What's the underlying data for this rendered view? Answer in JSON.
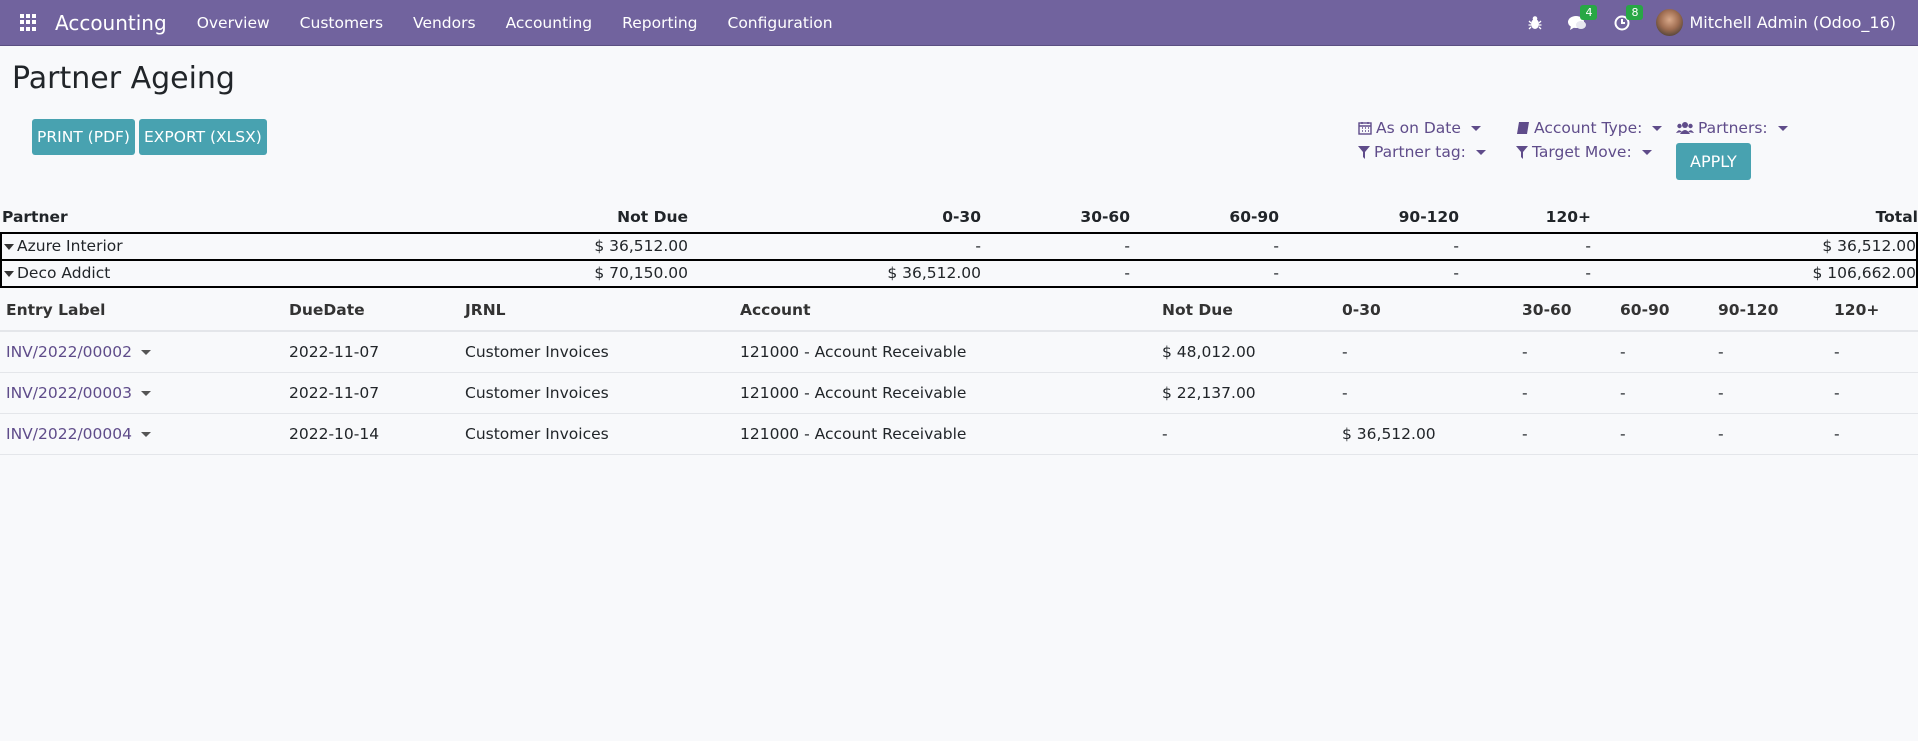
{
  "topbar": {
    "app_name": "Accounting",
    "menu": [
      "Overview",
      "Customers",
      "Vendors",
      "Accounting",
      "Reporting",
      "Configuration"
    ],
    "messages_count": "4",
    "activities_count": "8",
    "user": "Mitchell Admin (Odoo_16)",
    "bar_color": "#71639e"
  },
  "page": {
    "title": "Partner Ageing",
    "print_label": "PRINT (PDF)",
    "export_label": "EXPORT (XLSX)",
    "accent_color": "#48a2b0"
  },
  "filters": {
    "as_on_date": "As on Date",
    "account_type": "Account Type:",
    "partners": "Partners:",
    "partner_tag": "Partner tag:",
    "target_move": "Target Move:",
    "apply": "APPLY"
  },
  "summary": {
    "headers": [
      "Partner",
      "Not Due",
      "0-30",
      "30-60",
      "60-90",
      "90-120",
      "120+",
      "Total"
    ],
    "rows": [
      {
        "partner": "Azure Interior",
        "not_due": "$ 36,512.00",
        "d0_30": "-",
        "d30_60": "-",
        "d60_90": "-",
        "d90_120": "-",
        "d120": "-",
        "total": "$ 36,512.00"
      },
      {
        "partner": "Deco Addict",
        "not_due": "$ 70,150.00",
        "d0_30": "$ 36,512.00",
        "d30_60": "-",
        "d60_90": "-",
        "d90_120": "-",
        "d120": "-",
        "total": "$ 106,662.00"
      }
    ]
  },
  "detail": {
    "headers": [
      "Entry Label",
      "DueDate",
      "JRNL",
      "Account",
      "Not Due",
      "0-30",
      "30-60",
      "60-90",
      "90-120",
      "120+"
    ],
    "rows": [
      {
        "entry": "INV/2022/00002",
        "due": "2022-11-07",
        "jrnl": "Customer Invoices",
        "account": "121000 - Account Receivable",
        "not_due": "$ 48,012.00",
        "d0_30": "-",
        "d30_60": "-",
        "d60_90": "-",
        "d90_120": "-",
        "d120": "-"
      },
      {
        "entry": "INV/2022/00003",
        "due": "2022-11-07",
        "jrnl": "Customer Invoices",
        "account": "121000 - Account Receivable",
        "not_due": "$ 22,137.00",
        "d0_30": "-",
        "d30_60": "-",
        "d60_90": "-",
        "d90_120": "-",
        "d120": "-"
      },
      {
        "entry": "INV/2022/00004",
        "due": "2022-10-14",
        "jrnl": "Customer Invoices",
        "account": "121000 - Account Receivable",
        "not_due": "-",
        "d0_30": "$ 36,512.00",
        "d30_60": "-",
        "d60_90": "-",
        "d90_120": "-",
        "d120": "-"
      }
    ]
  }
}
